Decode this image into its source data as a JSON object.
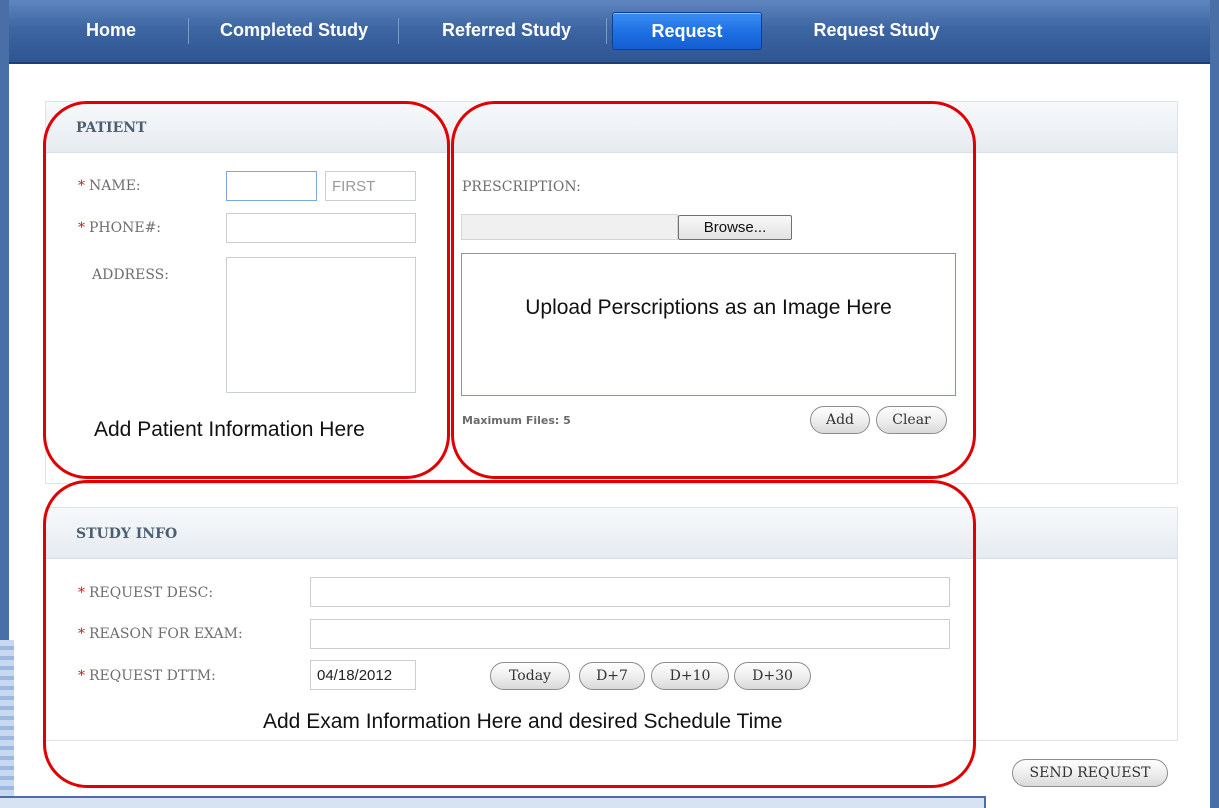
{
  "nav": {
    "items": [
      {
        "label": "Home"
      },
      {
        "label": "Completed Study"
      },
      {
        "label": "Referred Study"
      },
      {
        "label": "Request"
      },
      {
        "label": "Request Study"
      }
    ],
    "active_index": 3
  },
  "patient": {
    "title": "PATIENT",
    "name_label": "NAME:",
    "name_value": "",
    "first_placeholder": "FIRST",
    "phone_label": "PHONE#:",
    "phone_value": "",
    "address_label": "ADDRESS:",
    "address_value": "",
    "annotation": "Add Patient Information Here"
  },
  "prescription": {
    "label": "PRESCRIPTION:",
    "browse_button": "Browse...",
    "upload_annotation": "Upload Perscriptions as an Image Here",
    "max_files": "Maximum Files: 5",
    "add_button": "Add",
    "clear_button": "Clear"
  },
  "study_info": {
    "title": "STUDY INFO",
    "request_desc_label": "REQUEST DESC:",
    "request_desc_value": "",
    "reason_label": "REASON FOR EXAM:",
    "reason_value": "",
    "dttm_label": "REQUEST DTTM:",
    "dttm_value": "04/18/2012",
    "quick_dates": [
      "Today",
      "D+7",
      "D+10",
      "D+30"
    ],
    "annotation": "Add Exam Information Here and desired Schedule Time"
  },
  "send_button": "SEND REQUEST",
  "colors": {
    "nav_active": "#1d6fe3",
    "nav_bg": "#3d66a3",
    "required_star": "#d21616",
    "annotation_outline": "#e00000"
  }
}
